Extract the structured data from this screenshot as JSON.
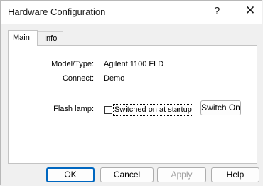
{
  "window": {
    "title": "Hardware Configuration",
    "help_glyph": "?",
    "close_glyph": "✕"
  },
  "tabs": [
    {
      "label": "Main",
      "active": true
    },
    {
      "label": "Info",
      "active": false
    }
  ],
  "form": {
    "model_label": "Model/Type:",
    "model_value": "Agilent 1100 FLD",
    "connect_label": "Connect:",
    "connect_value": "Demo",
    "flash_label": "Flash lamp:",
    "checkbox_label": "Switched on at startup",
    "checkbox_checked": false,
    "switch_button": "Switch On"
  },
  "buttons": {
    "ok": "OK",
    "cancel": "Cancel",
    "apply": "Apply",
    "help": "Help"
  }
}
